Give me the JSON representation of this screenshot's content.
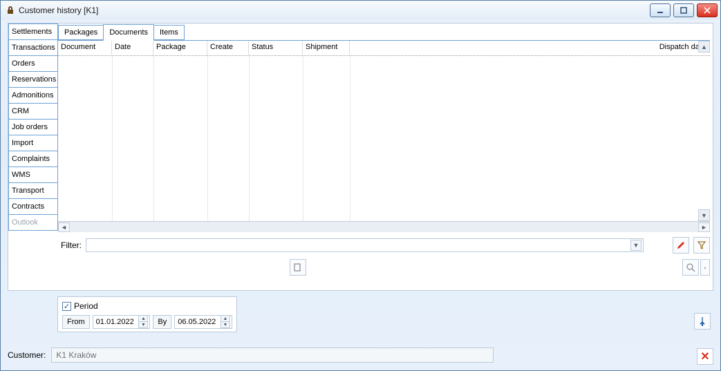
{
  "window": {
    "title": "Customer history [K1]"
  },
  "side_tabs": [
    "Settlements",
    "Transactions",
    "Orders",
    "Reservations",
    "Admonitions",
    "CRM",
    "Job orders",
    "Import",
    "Complaints",
    "WMS",
    "Transport",
    "Contracts",
    "Outlook"
  ],
  "side_disabled_index": 12,
  "top_tabs": [
    "Packages",
    "Documents",
    "Items"
  ],
  "top_active_index": 1,
  "grid_columns": [
    "Document",
    "Date",
    "Package",
    "Create",
    "Status",
    "Shipment",
    "Dispatch date"
  ],
  "filter": {
    "label": "Filter:",
    "value": ""
  },
  "period": {
    "checkbox_label": "Period",
    "checked": true,
    "from_label": "From",
    "from_value": "01.01.2022",
    "by_label": "By",
    "by_value": "06.05.2022"
  },
  "customer": {
    "label": "Customer:",
    "value": "K1 Kraków"
  }
}
